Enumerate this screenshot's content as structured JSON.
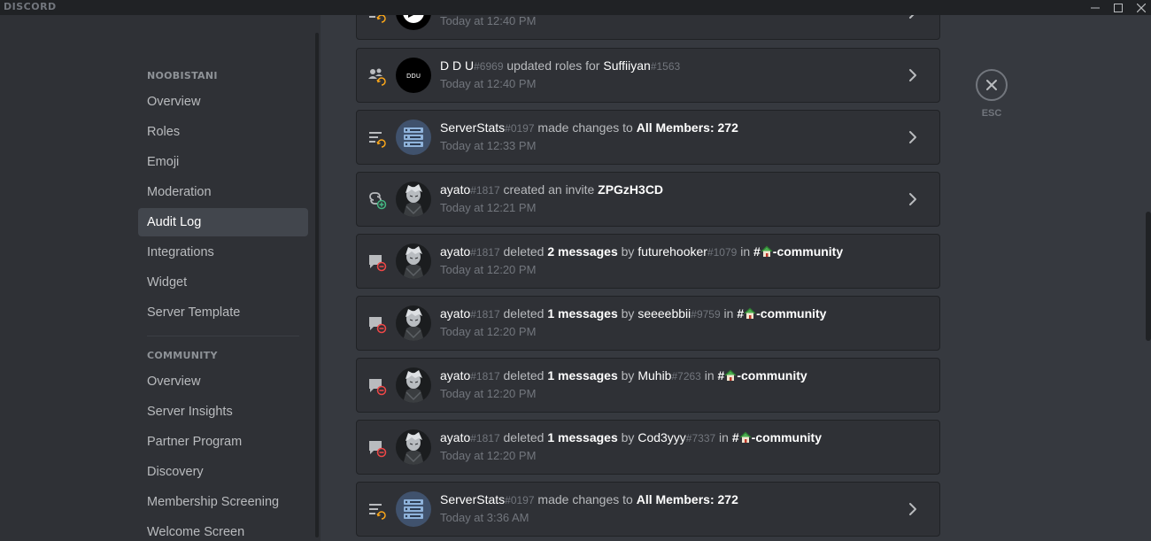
{
  "app": {
    "brand": "DISCORD"
  },
  "sidebar": {
    "server_header": "NOOBISTANI",
    "server_items": [
      {
        "label": "Overview"
      },
      {
        "label": "Roles"
      },
      {
        "label": "Emoji"
      },
      {
        "label": "Moderation"
      },
      {
        "label": "Audit Log",
        "active": true
      },
      {
        "label": "Integrations"
      },
      {
        "label": "Widget"
      },
      {
        "label": "Server Template"
      }
    ],
    "community_header": "COMMUNITY",
    "community_items": [
      {
        "label": "Overview"
      },
      {
        "label": "Server Insights"
      },
      {
        "label": "Partner Program"
      },
      {
        "label": "Discovery"
      },
      {
        "label": "Membership Screening"
      },
      {
        "label": "Welcome Screen"
      }
    ]
  },
  "esc": {
    "label": "ESC"
  },
  "entries": [
    {
      "time": "Today at 12:40 PM"
    },
    {
      "user": "D D U",
      "disc": "#6969",
      "action": " updated roles for ",
      "target": "Suffiiyan",
      "target_disc": "#1563",
      "time": "Today at 12:40 PM"
    },
    {
      "user": "ServerStats",
      "disc": "#0197",
      "action": " made changes to ",
      "target": "All Members: 272",
      "time": "Today at 12:33 PM"
    },
    {
      "user": "ayato",
      "disc": "#1817",
      "action": " created an invite ",
      "target": "ZPGzH3CD",
      "time": "Today at 12:21 PM"
    },
    {
      "user": "ayato",
      "disc": "#1817",
      "action": " deleted ",
      "count": "2 messages",
      "by": " by ",
      "target": "futurehooker",
      "target_disc": "#1079",
      "in": " in ",
      "channel": "#",
      "channel_name": "-community",
      "time": "Today at 12:20 PM"
    },
    {
      "user": "ayato",
      "disc": "#1817",
      "action": " deleted ",
      "count": "1 messages",
      "by": " by ",
      "target": "seeeebbii",
      "target_disc": "#9759",
      "in": " in ",
      "channel": "#",
      "channel_name": "-community",
      "time": "Today at 12:20 PM"
    },
    {
      "user": "ayato",
      "disc": "#1817",
      "action": " deleted ",
      "count": "1 messages",
      "by": " by ",
      "target": "Muhib",
      "target_disc": "#7263",
      "in": " in ",
      "channel": "#",
      "channel_name": "-community",
      "time": "Today at 12:20 PM"
    },
    {
      "user": "ayato",
      "disc": "#1817",
      "action": " deleted ",
      "count": "1 messages",
      "by": " by ",
      "target": "Cod3yyy",
      "target_disc": "#7337",
      "in": " in ",
      "channel": "#",
      "channel_name": "-community",
      "time": "Today at 12:20 PM"
    },
    {
      "user": "ServerStats",
      "disc": "#0197",
      "action": " made changes to ",
      "target": "All Members: 272",
      "time": "Today at 3:36 AM"
    }
  ]
}
